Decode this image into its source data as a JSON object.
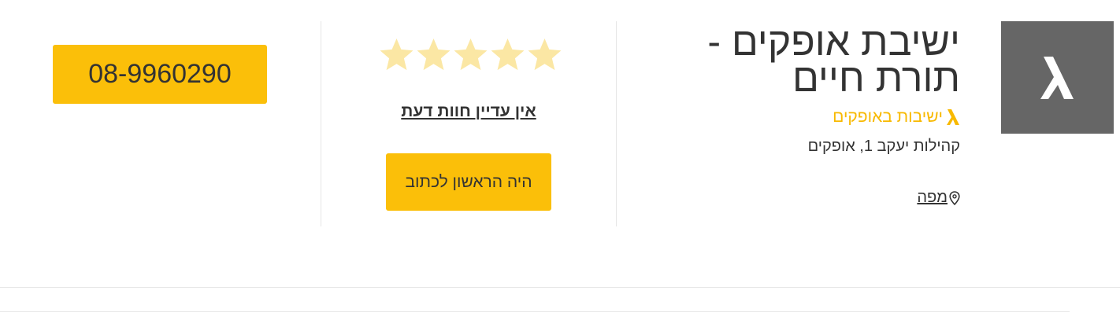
{
  "business": {
    "title": "ישיבת אופקים - תורת חיים",
    "category": "ישיבות באופקים",
    "address": "קהילות יעקב 1, אופקים",
    "map_label": "מפה",
    "logo_icon": "lambda-logo-icon"
  },
  "reviews": {
    "rating": 0,
    "max_rating": 5,
    "empty_star_color": "#fbe7a4",
    "no_reviews_label": "אין עדיין חוות דעת",
    "write_first_label": "היה הראשון לכתוב"
  },
  "contact": {
    "phone": "08-9960290"
  },
  "colors": {
    "accent": "#fbbf09",
    "category_text": "#f8b900",
    "logo_bg": "#666666"
  }
}
